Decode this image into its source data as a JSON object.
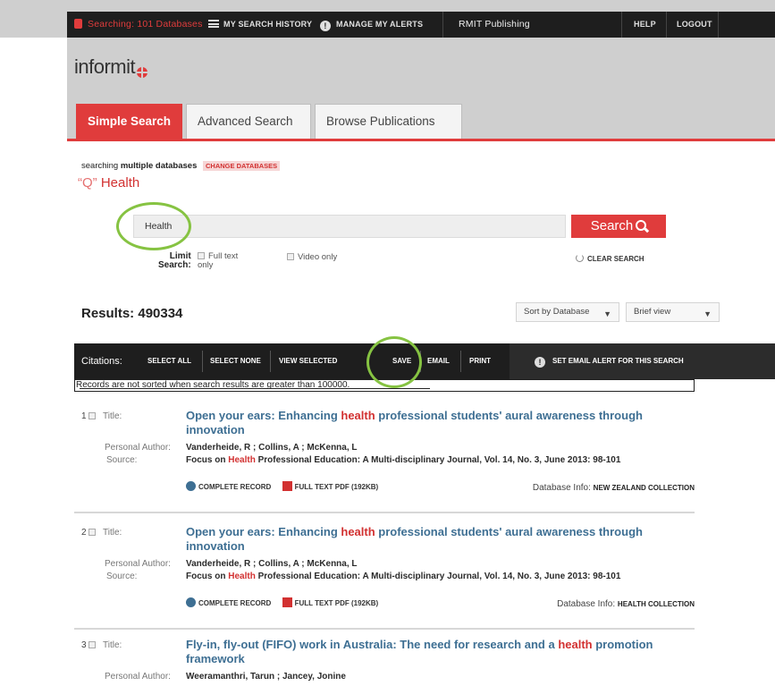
{
  "topbar": {
    "searching": "Searching: 101 Databases",
    "history": "MY SEARCH HISTORY",
    "alerts": "MANAGE MY ALERTS",
    "publisher": "RMIT Publishing",
    "help": "HELP",
    "logout": "LOGOUT"
  },
  "brand": {
    "logo": "informit"
  },
  "tabs": [
    {
      "label": "Simple Search",
      "active": true
    },
    {
      "label": "Advanced Search",
      "active": false
    },
    {
      "label": "Browse Publications",
      "active": false
    }
  ],
  "search": {
    "scope_prefix": "searching",
    "scope_bold": "multiple databases",
    "change_db": "CHANGE DATABASES",
    "query_quote": "“Q”",
    "query_term": "Health",
    "input_value": "Health",
    "button_label": "Search",
    "limit_label_line1": "Limit",
    "limit_label_line2": "Search:",
    "opt_full_text": "Full text",
    "opt_full_text_line2": "only",
    "opt_video": "Video only",
    "clear": "CLEAR SEARCH"
  },
  "results": {
    "count_label": "Results: 490334",
    "sort_value": "Sort by Database",
    "view_value": "Brief view"
  },
  "citations": {
    "label": "Citations:",
    "select_all": "SELECT ALL",
    "select_none": "SELECT NONE",
    "view_selected": "VIEW SELECTED",
    "save": "SAVE",
    "email": "EMAIL",
    "print": "PRINT",
    "alert": "SET EMAIL ALERT FOR THIS SEARCH"
  },
  "notice": "Records are not sorted when search results are greater than 100000.",
  "labels": {
    "title": "Title:",
    "author": "Personal Author:",
    "source": "Source:",
    "complete_record": "COMPLETE RECORD",
    "full_text_pdf": "FULL TEXT PDF (192KB)",
    "db_info": "Database Info:"
  },
  "records": [
    {
      "num": "1",
      "title_a": "Open your ears: Enhancing ",
      "title_hl": "health",
      "title_b": " professional students' aural awareness through innovation",
      "author": "Vanderheide, R ;  Collins, A ;  McKenna, L",
      "source_a": "Focus on ",
      "source_hl": "Health",
      "source_b": " Professional Education: A Multi-disciplinary Journal, Vol. 14, No. 3, June 2013: 98-101",
      "db": "NEW ZEALAND COLLECTION"
    },
    {
      "num": "2",
      "title_a": "Open your ears: Enhancing ",
      "title_hl": "health",
      "title_b": " professional students' aural awareness through innovation",
      "author": "Vanderheide, R ;  Collins, A ;  McKenna, L",
      "source_a": "Focus on ",
      "source_hl": "Health",
      "source_b": " Professional Education: A Multi-disciplinary Journal, Vol. 14, No. 3, June 2013: 98-101",
      "db": "HEALTH COLLECTION"
    },
    {
      "num": "3",
      "title_a": "Fly-in, fly-out (FIFO) work in Australia: The need for research and a ",
      "title_hl": "health",
      "title_b": " promotion framework",
      "author": "Weeramanthri, Tarun ;  Jancey, Jonine"
    }
  ],
  "colors": {
    "accent": "#e03c3c",
    "link": "#3e6f93",
    "highlight_ring": "#86c342",
    "topbar": "#1e1e1e"
  }
}
